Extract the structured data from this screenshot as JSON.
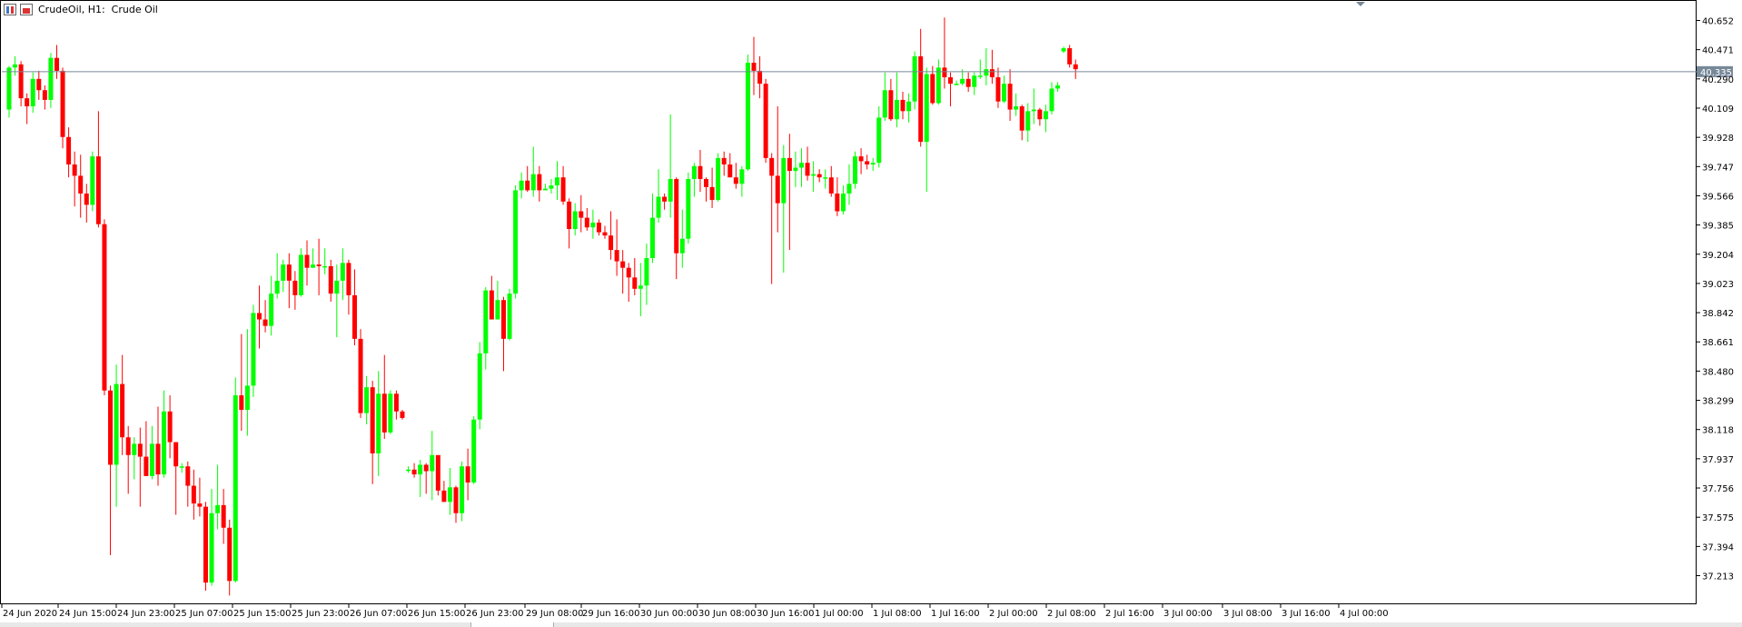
{
  "header": {
    "title": "CrudeOil, H1:  Crude Oil"
  },
  "colors": {
    "bull": "#00ff00",
    "bear": "#ff0000",
    "price_line": "#778899",
    "price_tag_bg": "#778899"
  },
  "chart_data": {
    "type": "candlestick",
    "symbol": "CrudeOil",
    "timeframe": "H1",
    "current_price_label": "40.335",
    "current_price": 40.335,
    "ylim": [
      37.1,
      40.72
    ],
    "y_ticks": [
      "40.652",
      "40.471",
      "40.290",
      "40.109",
      "39.928",
      "39.747",
      "39.566",
      "39.385",
      "39.204",
      "39.023",
      "38.842",
      "38.661",
      "38.480",
      "38.299",
      "38.118",
      "37.937",
      "37.756",
      "37.575",
      "37.394",
      "37.213"
    ],
    "x_tick_labels": [
      "24 Jun 2020",
      "24 Jun 15:00",
      "24 Jun 23:00",
      "25 Jun 07:00",
      "25 Jun 15:00",
      "25 Jun 23:00",
      "26 Jun 07:00",
      "26 Jun 15:00",
      "26 Jun 23:00",
      "29 Jun 08:00",
      "29 Jun 16:00",
      "30 Jun 00:00",
      "30 Jun 08:00",
      "30 Jun 16:00",
      "1 Jul 00:00",
      "1 Jul 08:00",
      "1 Jul 16:00",
      "2 Jul 00:00",
      "2 Jul 08:00",
      "2 Jul 16:00",
      "3 Jul 00:00",
      "3 Jul 08:00",
      "3 Jul 16:00",
      "4 Jul 00:00"
    ],
    "candles": [
      [
        40.1,
        40.36,
        40.05,
        40.37
      ],
      [
        40.36,
        40.38,
        40.31,
        40.43
      ],
      [
        40.38,
        40.17,
        40.12,
        40.4
      ],
      [
        40.17,
        40.12,
        40.01,
        40.2
      ],
      [
        40.12,
        40.29,
        40.08,
        40.33
      ],
      [
        40.29,
        40.22,
        40.16,
        40.34
      ],
      [
        40.22,
        40.16,
        40.1,
        40.25
      ],
      [
        40.16,
        40.42,
        40.11,
        40.45
      ],
      [
        40.42,
        40.34,
        40.29,
        40.5
      ],
      [
        40.34,
        39.93,
        39.86,
        40.36
      ],
      [
        39.93,
        39.76,
        39.68,
        39.99
      ],
      [
        39.76,
        39.69,
        39.5,
        39.84
      ],
      [
        39.69,
        39.58,
        39.43,
        39.82
      ],
      [
        39.58,
        39.51,
        39.4,
        39.64
      ],
      [
        39.51,
        39.81,
        39.47,
        39.84
      ],
      [
        39.81,
        39.39,
        39.37,
        40.09
      ],
      [
        39.39,
        38.36,
        38.33,
        39.42
      ],
      [
        38.36,
        37.9,
        37.34,
        38.39
      ],
      [
        37.9,
        38.4,
        37.64,
        38.52
      ],
      [
        38.4,
        38.07,
        37.96,
        38.58
      ],
      [
        38.07,
        37.96,
        37.72,
        38.14
      ],
      [
        37.96,
        38.03,
        37.81,
        38.07
      ],
      [
        38.03,
        37.95,
        37.64,
        38.13
      ],
      [
        37.95,
        37.83,
        37.83,
        38.17
      ],
      [
        37.83,
        38.03,
        37.81,
        38.14
      ],
      [
        38.03,
        37.84,
        37.77,
        38.26
      ],
      [
        37.84,
        38.23,
        37.82,
        38.36
      ],
      [
        38.23,
        38.04,
        37.94,
        38.33
      ],
      [
        38.04,
        37.89,
        37.59,
        37.9
      ],
      [
        37.89,
        37.89,
        37.85,
        37.91
      ],
      [
        37.89,
        37.77,
        37.64,
        37.92
      ],
      [
        37.77,
        37.66,
        37.56,
        37.87
      ],
      [
        37.66,
        37.64,
        37.58,
        37.82
      ],
      [
        37.64,
        37.17,
        37.12,
        37.67
      ],
      [
        37.17,
        37.6,
        37.15,
        37.75
      ],
      [
        37.6,
        37.65,
        37.5,
        37.9
      ],
      [
        37.65,
        37.51,
        37.41,
        37.75
      ],
      [
        37.51,
        37.18,
        37.09,
        37.56
      ],
      [
        37.18,
        38.33,
        37.17,
        38.44
      ],
      [
        38.33,
        38.24,
        38.11,
        38.71
      ],
      [
        38.24,
        38.39,
        38.08,
        38.74
      ],
      [
        38.39,
        38.84,
        38.32,
        38.89
      ],
      [
        38.84,
        38.8,
        38.62,
        39.01
      ],
      [
        38.8,
        38.76,
        38.72,
        38.92
      ],
      [
        38.76,
        38.96,
        38.7,
        39.07
      ],
      [
        38.96,
        39.04,
        38.93,
        39.21
      ],
      [
        39.04,
        39.14,
        38.97,
        39.17
      ],
      [
        39.14,
        39.04,
        38.87,
        39.21
      ],
      [
        39.04,
        38.95,
        38.86,
        39.1
      ],
      [
        38.95,
        39.2,
        38.94,
        39.24
      ],
      [
        39.2,
        39.12,
        39.01,
        39.29
      ],
      [
        39.12,
        39.14,
        39.12,
        39.24
      ],
      [
        39.14,
        39.13,
        38.95,
        39.3
      ],
      [
        39.13,
        39.13,
        39.08,
        39.24
      ],
      [
        39.13,
        38.96,
        38.91,
        39.17
      ],
      [
        38.96,
        39.04,
        38.69,
        39.14
      ],
      [
        39.04,
        39.15,
        38.92,
        39.24
      ],
      [
        39.15,
        38.95,
        38.83,
        39.17
      ],
      [
        38.95,
        38.68,
        38.64,
        39.11
      ],
      [
        38.68,
        38.22,
        38.19,
        38.74
      ],
      [
        38.22,
        38.38,
        38.15,
        38.45
      ],
      [
        38.38,
        37.97,
        37.78,
        38.42
      ],
      [
        37.97,
        38.34,
        37.83,
        38.48
      ],
      [
        38.34,
        38.1,
        38.06,
        38.58
      ],
      [
        38.1,
        38.34,
        38.09,
        38.36
      ],
      [
        38.34,
        38.23,
        38.18,
        38.36
      ],
      [
        38.23,
        38.19,
        38.18,
        38.24
      ],
      [
        37.87,
        37.87,
        37.85,
        37.89
      ],
      [
        37.87,
        37.84,
        37.82,
        37.91
      ],
      [
        37.84,
        37.9,
        37.7,
        37.93
      ],
      [
        37.9,
        37.86,
        37.72,
        37.91
      ],
      [
        37.86,
        37.96,
        37.68,
        38.11
      ],
      [
        37.96,
        37.74,
        37.71,
        37.93
      ],
      [
        37.74,
        37.67,
        37.67,
        37.8
      ],
      [
        37.67,
        37.76,
        37.59,
        37.88
      ],
      [
        37.76,
        37.6,
        37.54,
        37.77
      ],
      [
        37.6,
        37.89,
        37.55,
        37.92
      ],
      [
        37.89,
        37.79,
        37.68,
        38.0
      ],
      [
        37.79,
        38.18,
        37.78,
        38.2
      ],
      [
        38.18,
        38.59,
        38.12,
        38.66
      ],
      [
        38.59,
        38.98,
        38.49,
        39.0
      ],
      [
        38.98,
        38.8,
        38.8,
        39.07
      ],
      [
        38.8,
        38.92,
        38.81,
        39.04
      ],
      [
        38.92,
        38.68,
        38.48,
        38.94
      ],
      [
        38.68,
        38.96,
        38.67,
        38.99
      ],
      [
        38.96,
        39.6,
        38.93,
        39.63
      ],
      [
        39.6,
        39.66,
        39.55,
        39.71
      ],
      [
        39.66,
        39.6,
        39.59,
        39.75
      ],
      [
        39.6,
        39.7,
        39.56,
        39.87
      ],
      [
        39.7,
        39.6,
        39.53,
        39.75
      ],
      [
        39.6,
        39.61,
        39.6,
        39.64
      ],
      [
        39.61,
        39.63,
        39.58,
        39.67
      ],
      [
        39.63,
        39.68,
        39.54,
        39.78
      ],
      [
        39.68,
        39.53,
        39.51,
        39.75
      ],
      [
        39.53,
        39.36,
        39.24,
        39.55
      ],
      [
        39.36,
        39.47,
        39.32,
        39.52
      ],
      [
        39.47,
        39.43,
        39.34,
        39.57
      ],
      [
        39.43,
        39.37,
        39.35,
        39.49
      ],
      [
        39.37,
        39.4,
        39.3,
        39.48
      ],
      [
        39.4,
        39.34,
        39.32,
        39.42
      ],
      [
        39.34,
        39.32,
        39.3,
        39.38
      ],
      [
        39.32,
        39.23,
        39.17,
        39.47
      ],
      [
        39.23,
        39.16,
        39.07,
        39.42
      ],
      [
        39.16,
        39.12,
        38.96,
        39.23
      ],
      [
        39.12,
        39.06,
        38.91,
        39.15
      ],
      [
        39.06,
        38.99,
        38.95,
        39.18
      ],
      [
        38.99,
        39.01,
        38.82,
        39.15
      ],
      [
        39.01,
        39.18,
        38.89,
        39.27
      ],
      [
        39.18,
        39.43,
        39.15,
        39.58
      ],
      [
        39.43,
        39.56,
        39.4,
        39.73
      ],
      [
        39.56,
        39.53,
        39.48,
        39.58
      ],
      [
        39.53,
        39.67,
        39.43,
        40.07
      ],
      [
        39.67,
        39.21,
        39.05,
        39.68
      ],
      [
        39.21,
        39.3,
        39.12,
        39.48
      ],
      [
        39.3,
        39.67,
        39.27,
        39.71
      ],
      [
        39.67,
        39.75,
        39.56,
        39.77
      ],
      [
        39.75,
        39.67,
        39.59,
        39.85
      ],
      [
        39.67,
        39.62,
        39.53,
        39.68
      ],
      [
        39.62,
        39.54,
        39.49,
        39.74
      ],
      [
        39.54,
        39.8,
        39.53,
        39.83
      ],
      [
        39.8,
        39.76,
        39.69,
        39.84
      ],
      [
        39.76,
        39.68,
        39.68,
        39.83
      ],
      [
        39.68,
        39.64,
        39.61,
        39.77
      ],
      [
        39.64,
        39.73,
        39.56,
        39.75
      ],
      [
        39.73,
        40.39,
        39.72,
        40.44
      ],
      [
        40.39,
        40.34,
        40.19,
        40.55
      ],
      [
        40.34,
        40.26,
        40.17,
        40.43
      ],
      [
        40.26,
        39.8,
        39.77,
        40.29
      ],
      [
        39.8,
        39.69,
        39.02,
        39.83
      ],
      [
        39.69,
        39.52,
        39.34,
        40.12
      ],
      [
        39.52,
        39.8,
        39.09,
        39.88
      ],
      [
        39.8,
        39.72,
        39.23,
        39.95
      ],
      [
        39.72,
        39.74,
        39.62,
        39.84
      ],
      [
        39.74,
        39.77,
        39.62,
        39.86
      ],
      [
        39.77,
        39.69,
        39.66,
        39.87
      ],
      [
        39.69,
        39.7,
        39.59,
        39.78
      ],
      [
        39.7,
        39.68,
        39.65,
        39.73
      ],
      [
        39.68,
        39.68,
        39.61,
        39.73
      ],
      [
        39.68,
        39.58,
        39.56,
        39.75
      ],
      [
        39.58,
        39.47,
        39.44,
        39.68
      ],
      [
        39.47,
        39.58,
        39.45,
        39.63
      ],
      [
        39.58,
        39.64,
        39.51,
        39.76
      ],
      [
        39.64,
        39.81,
        39.61,
        39.84
      ],
      [
        39.81,
        39.78,
        39.7,
        39.86
      ],
      [
        39.78,
        39.76,
        39.73,
        39.82
      ],
      [
        39.76,
        39.77,
        39.72,
        39.8
      ],
      [
        39.77,
        40.05,
        39.74,
        40.12
      ],
      [
        40.05,
        40.22,
        40.03,
        40.33
      ],
      [
        40.22,
        40.04,
        40.03,
        40.29
      ],
      [
        40.04,
        40.16,
        39.99,
        40.33
      ],
      [
        40.16,
        40.09,
        40.04,
        40.21
      ],
      [
        40.09,
        40.15,
        40.02,
        40.2
      ],
      [
        40.15,
        40.43,
        40.1,
        40.46
      ],
      [
        40.43,
        39.9,
        39.87,
        40.6
      ],
      [
        39.9,
        40.32,
        39.59,
        40.36
      ],
      [
        40.32,
        40.14,
        40.13,
        40.37
      ],
      [
        40.14,
        40.36,
        40.13,
        40.41
      ],
      [
        40.36,
        40.3,
        40.23,
        40.67
      ],
      [
        40.3,
        40.26,
        40.12,
        40.33
      ],
      [
        40.26,
        40.26,
        40.25,
        40.28
      ],
      [
        40.26,
        40.29,
        40.25,
        40.35
      ],
      [
        40.29,
        40.24,
        40.21,
        40.33
      ],
      [
        40.24,
        40.31,
        40.19,
        40.33
      ],
      [
        40.31,
        40.31,
        40.29,
        40.41
      ],
      [
        40.31,
        40.35,
        40.25,
        40.48
      ],
      [
        40.35,
        40.3,
        40.26,
        40.47
      ],
      [
        40.3,
        40.15,
        40.11,
        40.36
      ],
      [
        40.15,
        40.26,
        40.14,
        40.31
      ],
      [
        40.26,
        40.1,
        40.03,
        40.35
      ],
      [
        40.1,
        40.12,
        40.06,
        40.2
      ],
      [
        40.12,
        39.97,
        39.91,
        40.13
      ],
      [
        39.97,
        40.09,
        39.9,
        40.14
      ],
      [
        40.09,
        40.1,
        40.01,
        40.23
      ],
      [
        40.1,
        40.04,
        40.0,
        40.11
      ],
      [
        40.04,
        40.09,
        39.96,
        40.13
      ],
      [
        40.09,
        40.23,
        40.07,
        40.27
      ],
      [
        40.23,
        40.25,
        40.21,
        40.27
      ],
      [
        40.46,
        40.48,
        40.45,
        40.49
      ],
      [
        40.48,
        40.38,
        40.36,
        40.5
      ],
      [
        40.38,
        40.35,
        40.29,
        40.41
      ]
    ]
  }
}
